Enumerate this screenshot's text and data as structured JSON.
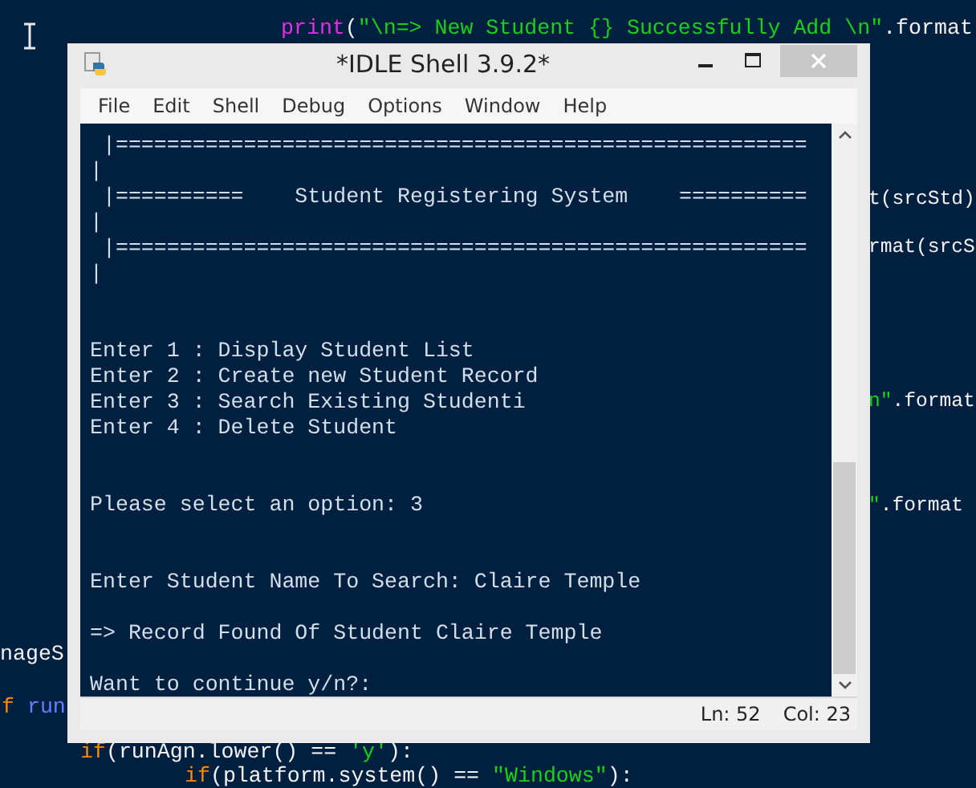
{
  "editor": {
    "fragments": [
      {
        "segments": [
          {
            "kind": "builtin",
            "text": "print"
          },
          {
            "kind": "plain",
            "text": "("
          },
          {
            "kind": "string",
            "text": "\"\\n=> New Student {} Successfully Add \\n\""
          },
          {
            "kind": "plain",
            "text": ".format"
          }
        ]
      },
      {
        "segments": [
          {
            "kind": "plain",
            "text": "t(srcStd)"
          }
        ]
      },
      {
        "segments": [
          {
            "kind": "plain",
            "text": "rmat(srcS"
          }
        ]
      },
      {
        "segments": [
          {
            "kind": "string",
            "text": "n\""
          },
          {
            "kind": "plain",
            "text": ".format"
          }
        ]
      },
      {
        "segments": [
          {
            "kind": "string",
            "text": "\""
          },
          {
            "kind": "plain",
            "text": ".format"
          }
        ]
      },
      {
        "segments": [
          {
            "kind": "plain",
            "text": "nageS"
          }
        ]
      },
      {
        "segments": [
          {
            "kind": "keyword",
            "text": "f"
          },
          {
            "kind": "name",
            "text": " run"
          }
        ]
      },
      {
        "segments": [
          {
            "kind": "keyword",
            "text": "if"
          },
          {
            "kind": "plain",
            "text": "(runAgn.lower() == "
          },
          {
            "kind": "string",
            "text": "'y'"
          },
          {
            "kind": "plain",
            "text": "):"
          }
        ]
      },
      {
        "segments": [
          {
            "kind": "keyword",
            "text": "if"
          },
          {
            "kind": "plain",
            "text": "(platform.system() == "
          },
          {
            "kind": "string",
            "text": "\"Windows\""
          },
          {
            "kind": "plain",
            "text": "):"
          }
        ]
      }
    ]
  },
  "window": {
    "title": "*IDLE Shell 3.9.2*"
  },
  "menu": [
    "File",
    "Edit",
    "Shell",
    "Debug",
    "Options",
    "Window",
    "Help"
  ],
  "shell": {
    "blocks": [
      {
        "kind": "banner",
        "lines": [
          " |======================================================",
          "|",
          " |==========    Student Registering System    ==========",
          "|",
          " |======================================================",
          "|"
        ]
      },
      {
        "kind": "menu",
        "lines": [
          "Enter 1 : Display Student List",
          "Enter 2 : Create new Student Record",
          "Enter 3 : Search Existing Studenti",
          "Enter 4 : Delete Student"
        ]
      },
      {
        "kind": "prompt",
        "lines": [
          "Please select an option: 3"
        ]
      },
      {
        "kind": "input",
        "lines": [
          "Enter Student Name To Search: Claire Temple"
        ]
      },
      {
        "kind": "output",
        "lines": [
          "=> Record Found Of Student Claire Temple"
        ]
      },
      {
        "kind": "question",
        "lines": [
          "Want to continue y/n?:"
        ]
      }
    ]
  },
  "status_bar": {
    "line": "Ln: 52",
    "column": "Col: 23"
  }
}
